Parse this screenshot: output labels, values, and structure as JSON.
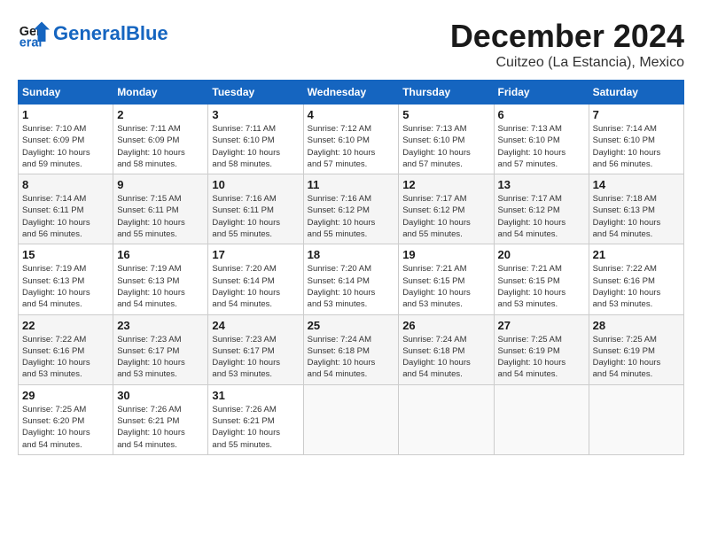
{
  "header": {
    "logo_text_general": "General",
    "logo_text_blue": "Blue",
    "month_title": "December 2024",
    "subtitle": "Cuitzeo (La Estancia), Mexico"
  },
  "weekdays": [
    "Sunday",
    "Monday",
    "Tuesday",
    "Wednesday",
    "Thursday",
    "Friday",
    "Saturday"
  ],
  "weeks": [
    [
      {
        "day": "1",
        "info": "Sunrise: 7:10 AM\nSunset: 6:09 PM\nDaylight: 10 hours\nand 59 minutes."
      },
      {
        "day": "2",
        "info": "Sunrise: 7:11 AM\nSunset: 6:09 PM\nDaylight: 10 hours\nand 58 minutes."
      },
      {
        "day": "3",
        "info": "Sunrise: 7:11 AM\nSunset: 6:10 PM\nDaylight: 10 hours\nand 58 minutes."
      },
      {
        "day": "4",
        "info": "Sunrise: 7:12 AM\nSunset: 6:10 PM\nDaylight: 10 hours\nand 57 minutes."
      },
      {
        "day": "5",
        "info": "Sunrise: 7:13 AM\nSunset: 6:10 PM\nDaylight: 10 hours\nand 57 minutes."
      },
      {
        "day": "6",
        "info": "Sunrise: 7:13 AM\nSunset: 6:10 PM\nDaylight: 10 hours\nand 57 minutes."
      },
      {
        "day": "7",
        "info": "Sunrise: 7:14 AM\nSunset: 6:10 PM\nDaylight: 10 hours\nand 56 minutes."
      }
    ],
    [
      {
        "day": "8",
        "info": "Sunrise: 7:14 AM\nSunset: 6:11 PM\nDaylight: 10 hours\nand 56 minutes."
      },
      {
        "day": "9",
        "info": "Sunrise: 7:15 AM\nSunset: 6:11 PM\nDaylight: 10 hours\nand 55 minutes."
      },
      {
        "day": "10",
        "info": "Sunrise: 7:16 AM\nSunset: 6:11 PM\nDaylight: 10 hours\nand 55 minutes."
      },
      {
        "day": "11",
        "info": "Sunrise: 7:16 AM\nSunset: 6:12 PM\nDaylight: 10 hours\nand 55 minutes."
      },
      {
        "day": "12",
        "info": "Sunrise: 7:17 AM\nSunset: 6:12 PM\nDaylight: 10 hours\nand 55 minutes."
      },
      {
        "day": "13",
        "info": "Sunrise: 7:17 AM\nSunset: 6:12 PM\nDaylight: 10 hours\nand 54 minutes."
      },
      {
        "day": "14",
        "info": "Sunrise: 7:18 AM\nSunset: 6:13 PM\nDaylight: 10 hours\nand 54 minutes."
      }
    ],
    [
      {
        "day": "15",
        "info": "Sunrise: 7:19 AM\nSunset: 6:13 PM\nDaylight: 10 hours\nand 54 minutes."
      },
      {
        "day": "16",
        "info": "Sunrise: 7:19 AM\nSunset: 6:13 PM\nDaylight: 10 hours\nand 54 minutes."
      },
      {
        "day": "17",
        "info": "Sunrise: 7:20 AM\nSunset: 6:14 PM\nDaylight: 10 hours\nand 54 minutes."
      },
      {
        "day": "18",
        "info": "Sunrise: 7:20 AM\nSunset: 6:14 PM\nDaylight: 10 hours\nand 53 minutes."
      },
      {
        "day": "19",
        "info": "Sunrise: 7:21 AM\nSunset: 6:15 PM\nDaylight: 10 hours\nand 53 minutes."
      },
      {
        "day": "20",
        "info": "Sunrise: 7:21 AM\nSunset: 6:15 PM\nDaylight: 10 hours\nand 53 minutes."
      },
      {
        "day": "21",
        "info": "Sunrise: 7:22 AM\nSunset: 6:16 PM\nDaylight: 10 hours\nand 53 minutes."
      }
    ],
    [
      {
        "day": "22",
        "info": "Sunrise: 7:22 AM\nSunset: 6:16 PM\nDaylight: 10 hours\nand 53 minutes."
      },
      {
        "day": "23",
        "info": "Sunrise: 7:23 AM\nSunset: 6:17 PM\nDaylight: 10 hours\nand 53 minutes."
      },
      {
        "day": "24",
        "info": "Sunrise: 7:23 AM\nSunset: 6:17 PM\nDaylight: 10 hours\nand 53 minutes."
      },
      {
        "day": "25",
        "info": "Sunrise: 7:24 AM\nSunset: 6:18 PM\nDaylight: 10 hours\nand 54 minutes."
      },
      {
        "day": "26",
        "info": "Sunrise: 7:24 AM\nSunset: 6:18 PM\nDaylight: 10 hours\nand 54 minutes."
      },
      {
        "day": "27",
        "info": "Sunrise: 7:25 AM\nSunset: 6:19 PM\nDaylight: 10 hours\nand 54 minutes."
      },
      {
        "day": "28",
        "info": "Sunrise: 7:25 AM\nSunset: 6:19 PM\nDaylight: 10 hours\nand 54 minutes."
      }
    ],
    [
      {
        "day": "29",
        "info": "Sunrise: 7:25 AM\nSunset: 6:20 PM\nDaylight: 10 hours\nand 54 minutes."
      },
      {
        "day": "30",
        "info": "Sunrise: 7:26 AM\nSunset: 6:21 PM\nDaylight: 10 hours\nand 54 minutes."
      },
      {
        "day": "31",
        "info": "Sunrise: 7:26 AM\nSunset: 6:21 PM\nDaylight: 10 hours\nand 55 minutes."
      },
      {
        "day": "",
        "info": ""
      },
      {
        "day": "",
        "info": ""
      },
      {
        "day": "",
        "info": ""
      },
      {
        "day": "",
        "info": ""
      }
    ]
  ]
}
